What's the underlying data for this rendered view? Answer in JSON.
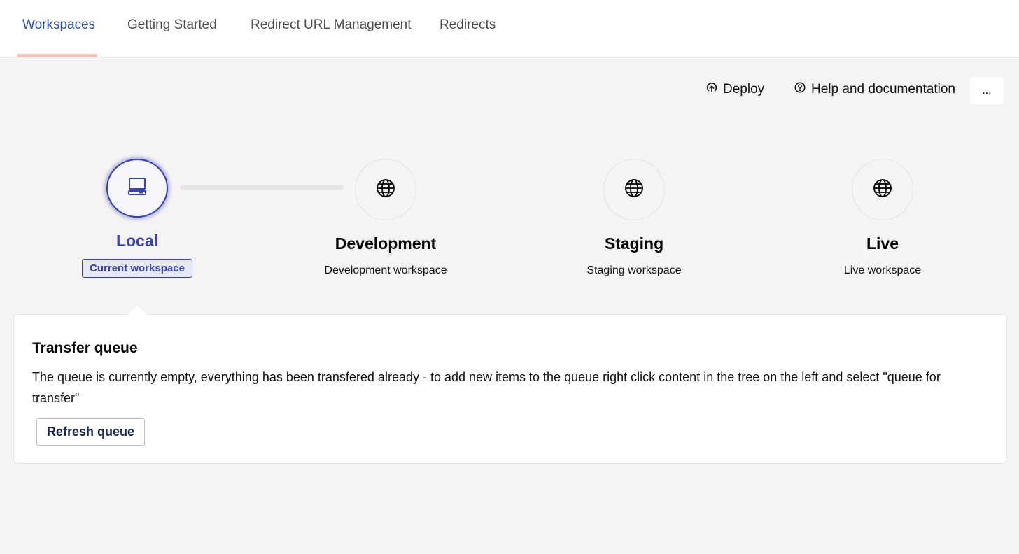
{
  "tabs": [
    {
      "label": "Workspaces",
      "active": true
    },
    {
      "label": "Getting Started",
      "active": false
    },
    {
      "label": "Redirect URL Management",
      "active": false
    },
    {
      "label": "Redirects",
      "active": false
    }
  ],
  "toolbar": {
    "deploy_label": "Deploy",
    "deploy_icon": "upload-circle-icon",
    "help_label": "Help and documentation",
    "help_icon": "question-circle-icon",
    "more_label": "..."
  },
  "workspaces": [
    {
      "name": "Local",
      "icon": "laptop-icon",
      "badge": "Current workspace",
      "current": true
    },
    {
      "name": "Development",
      "icon": "globe-icon",
      "subtitle": "Development workspace",
      "current": false
    },
    {
      "name": "Staging",
      "icon": "globe-icon",
      "subtitle": "Staging workspace",
      "current": false
    },
    {
      "name": "Live",
      "icon": "globe-icon",
      "subtitle": "Live workspace",
      "current": false
    }
  ],
  "queue": {
    "title": "Transfer queue",
    "message": "The queue is currently empty, everything has been transfered already - to add new items to the queue right click content in the tree on the left and select \"queue for transfer\"",
    "refresh_label": "Refresh queue"
  },
  "colors": {
    "accent": "#3544b1",
    "tab_active": "#2c4fa1",
    "tab_indicator": "#f3bfb8",
    "background": "#f5f3f3"
  }
}
